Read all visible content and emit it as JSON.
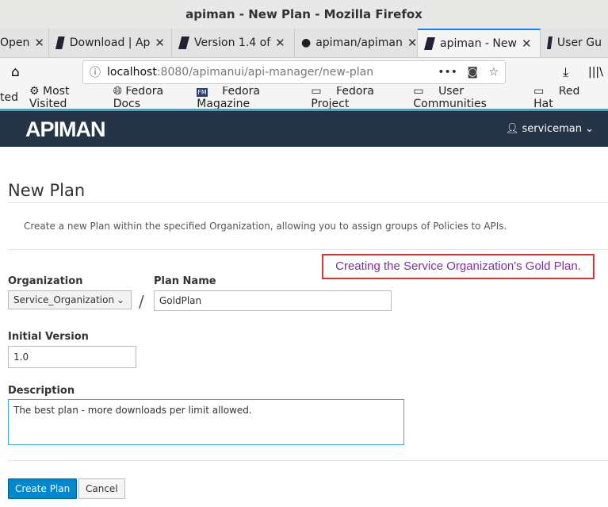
{
  "window_title": "apiman - New Plan - Mozilla Firefox",
  "tabs": [
    "Open",
    "Download | Ap",
    "Version 1.4 of",
    "apiman/apiman",
    "apiman - New",
    "User Gu"
  ],
  "url": {
    "host": "localhost",
    "path": ":8080/apimanui/api-manager/new-plan"
  },
  "bookmarks": [
    "ted",
    "Most Visited",
    "Fedora Docs",
    "Fedora Magazine",
    "Fedora Project",
    "User Communities",
    "Red Hat"
  ],
  "app": {
    "logo": "APIMAN",
    "user": "serviceman"
  },
  "page": {
    "title": "New Plan",
    "description": "Create a new Plan within the specified Organization, allowing you to assign groups of Policies to APIs.",
    "annotation": "Creating the Service Organization's Gold Plan.",
    "org_label": "Organization",
    "org_value": "Service_Organization",
    "separator": "/",
    "name_label": "Plan Name",
    "name_value": "GoldPlan",
    "version_label": "Initial Version",
    "version_value": "1.0",
    "desc_label": "Description",
    "desc_value": "The best plan - more downloads per limit allowed.",
    "create": "Create Plan",
    "cancel": "Cancel"
  }
}
